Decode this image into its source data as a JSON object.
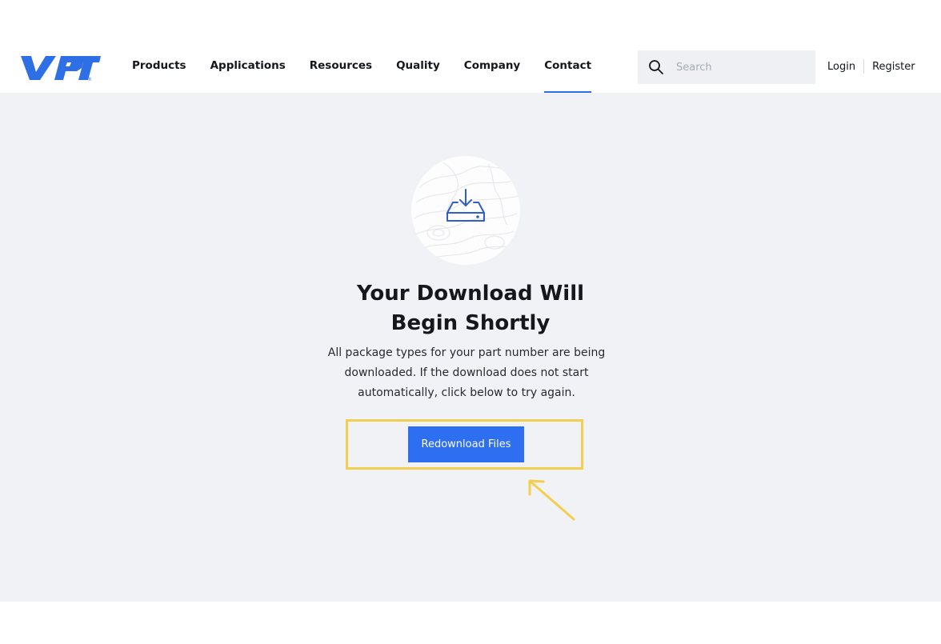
{
  "brand": {
    "logo_text": "VPT",
    "logo_mark": "®",
    "color": "#2f6fe6"
  },
  "nav": {
    "items": [
      {
        "label": "Products",
        "active": false
      },
      {
        "label": "Applications",
        "active": false
      },
      {
        "label": "Resources",
        "active": false
      },
      {
        "label": "Quality",
        "active": false
      },
      {
        "label": "Company",
        "active": false
      },
      {
        "label": "Contact",
        "active": true
      }
    ]
  },
  "search": {
    "placeholder": "Search",
    "value": "",
    "icon": "search-icon"
  },
  "auth": {
    "login": "Login",
    "register": "Register"
  },
  "download": {
    "icon": "download-tray-icon",
    "heading_line1": "Your Download Will",
    "heading_line2": "Begin Shortly",
    "description": "All package types for your part number are being downloaded. If the download does not start automatically, click below to try again.",
    "button_label": "Redownload Files"
  },
  "annotation": {
    "highlight_color": "#f4cf4f",
    "arrow_icon": "arrow-up-left-icon"
  },
  "colors": {
    "accent": "#2e6ef0",
    "background": "#f1f2f6",
    "text": "#14171c"
  }
}
